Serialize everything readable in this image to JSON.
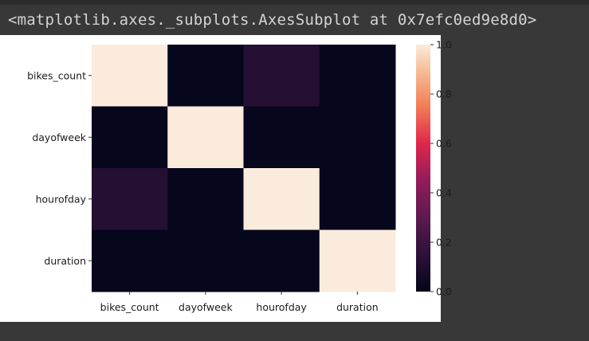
{
  "output": {
    "repr_text": "<matplotlib.axes._subplots.AxesSubplot at 0x7efc0ed9e8d0>"
  },
  "chart_data": {
    "type": "heatmap",
    "title": "",
    "xlabel": "",
    "ylabel": "",
    "row_labels": [
      "bikes_count",
      "dayofweek",
      "hourofday",
      "duration"
    ],
    "col_labels": [
      "bikes_count",
      "dayofweek",
      "hourofday",
      "duration"
    ],
    "values": [
      [
        1.0,
        0.01,
        0.12,
        0.01
      ],
      [
        0.01,
        1.0,
        0.01,
        0.01
      ],
      [
        0.12,
        0.01,
        1.0,
        0.01
      ],
      [
        0.01,
        0.01,
        0.01,
        1.0
      ]
    ],
    "colorbar": {
      "range": [
        0.0,
        1.0
      ],
      "ticks": [
        "0.0",
        "0.2",
        "0.4",
        "0.6",
        "0.8",
        "1.0"
      ],
      "colormap": "rocket"
    },
    "colors": {
      "page_background": "#383838",
      "plot_background": "#ffffff"
    }
  }
}
